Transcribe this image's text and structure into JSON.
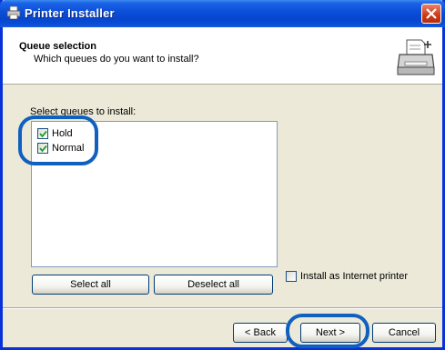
{
  "window": {
    "title": "Printer Installer"
  },
  "header": {
    "title": "Queue selection",
    "subtitle": "Which queues do you want to install?"
  },
  "queues": {
    "label": "Select queues to install:",
    "items": [
      {
        "label": "Hold",
        "checked": true
      },
      {
        "label": "Normal",
        "checked": true
      }
    ]
  },
  "buttons": {
    "select_all": "Select all",
    "deselect_all": "Deselect all",
    "back": "< Back",
    "next": "Next >",
    "cancel": "Cancel"
  },
  "internet_printer": {
    "label": "Install as Internet printer",
    "checked": false
  },
  "icons": {
    "title": "printer-icon",
    "header": "printer-add-icon",
    "close": "close-icon",
    "check": "checkmark-icon"
  },
  "colors": {
    "title_bar": "#0a4ed8",
    "face": "#ece9d8",
    "highlight_ring": "#1060c0"
  }
}
